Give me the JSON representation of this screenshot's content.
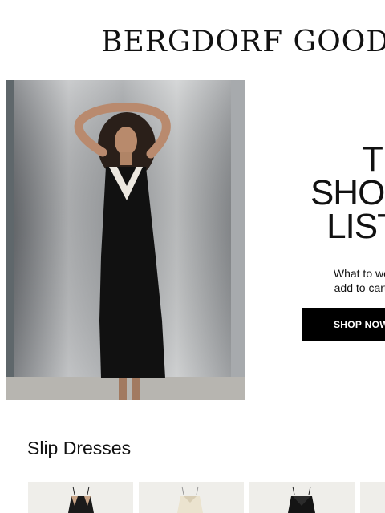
{
  "header": {
    "logo_text": "BERGDORF GOODMAN"
  },
  "hero": {
    "headline_lines": [
      "THE",
      "SHOPP",
      "LIST"
    ],
    "subcopy_lines": [
      "What to wear, ca",
      "add to cart this s"
    ],
    "cta_label": "SHOP NOW"
  },
  "section": {
    "title": "Slip Dresses"
  },
  "products": [
    {
      "name": "product-card-1",
      "icon": "slip-dress-black-nude"
    },
    {
      "name": "product-card-2",
      "icon": "slip-dress-ivory"
    },
    {
      "name": "product-card-3",
      "icon": "slip-dress-black-lace"
    },
    {
      "name": "product-card-4",
      "icon": "slip-dress"
    }
  ]
}
